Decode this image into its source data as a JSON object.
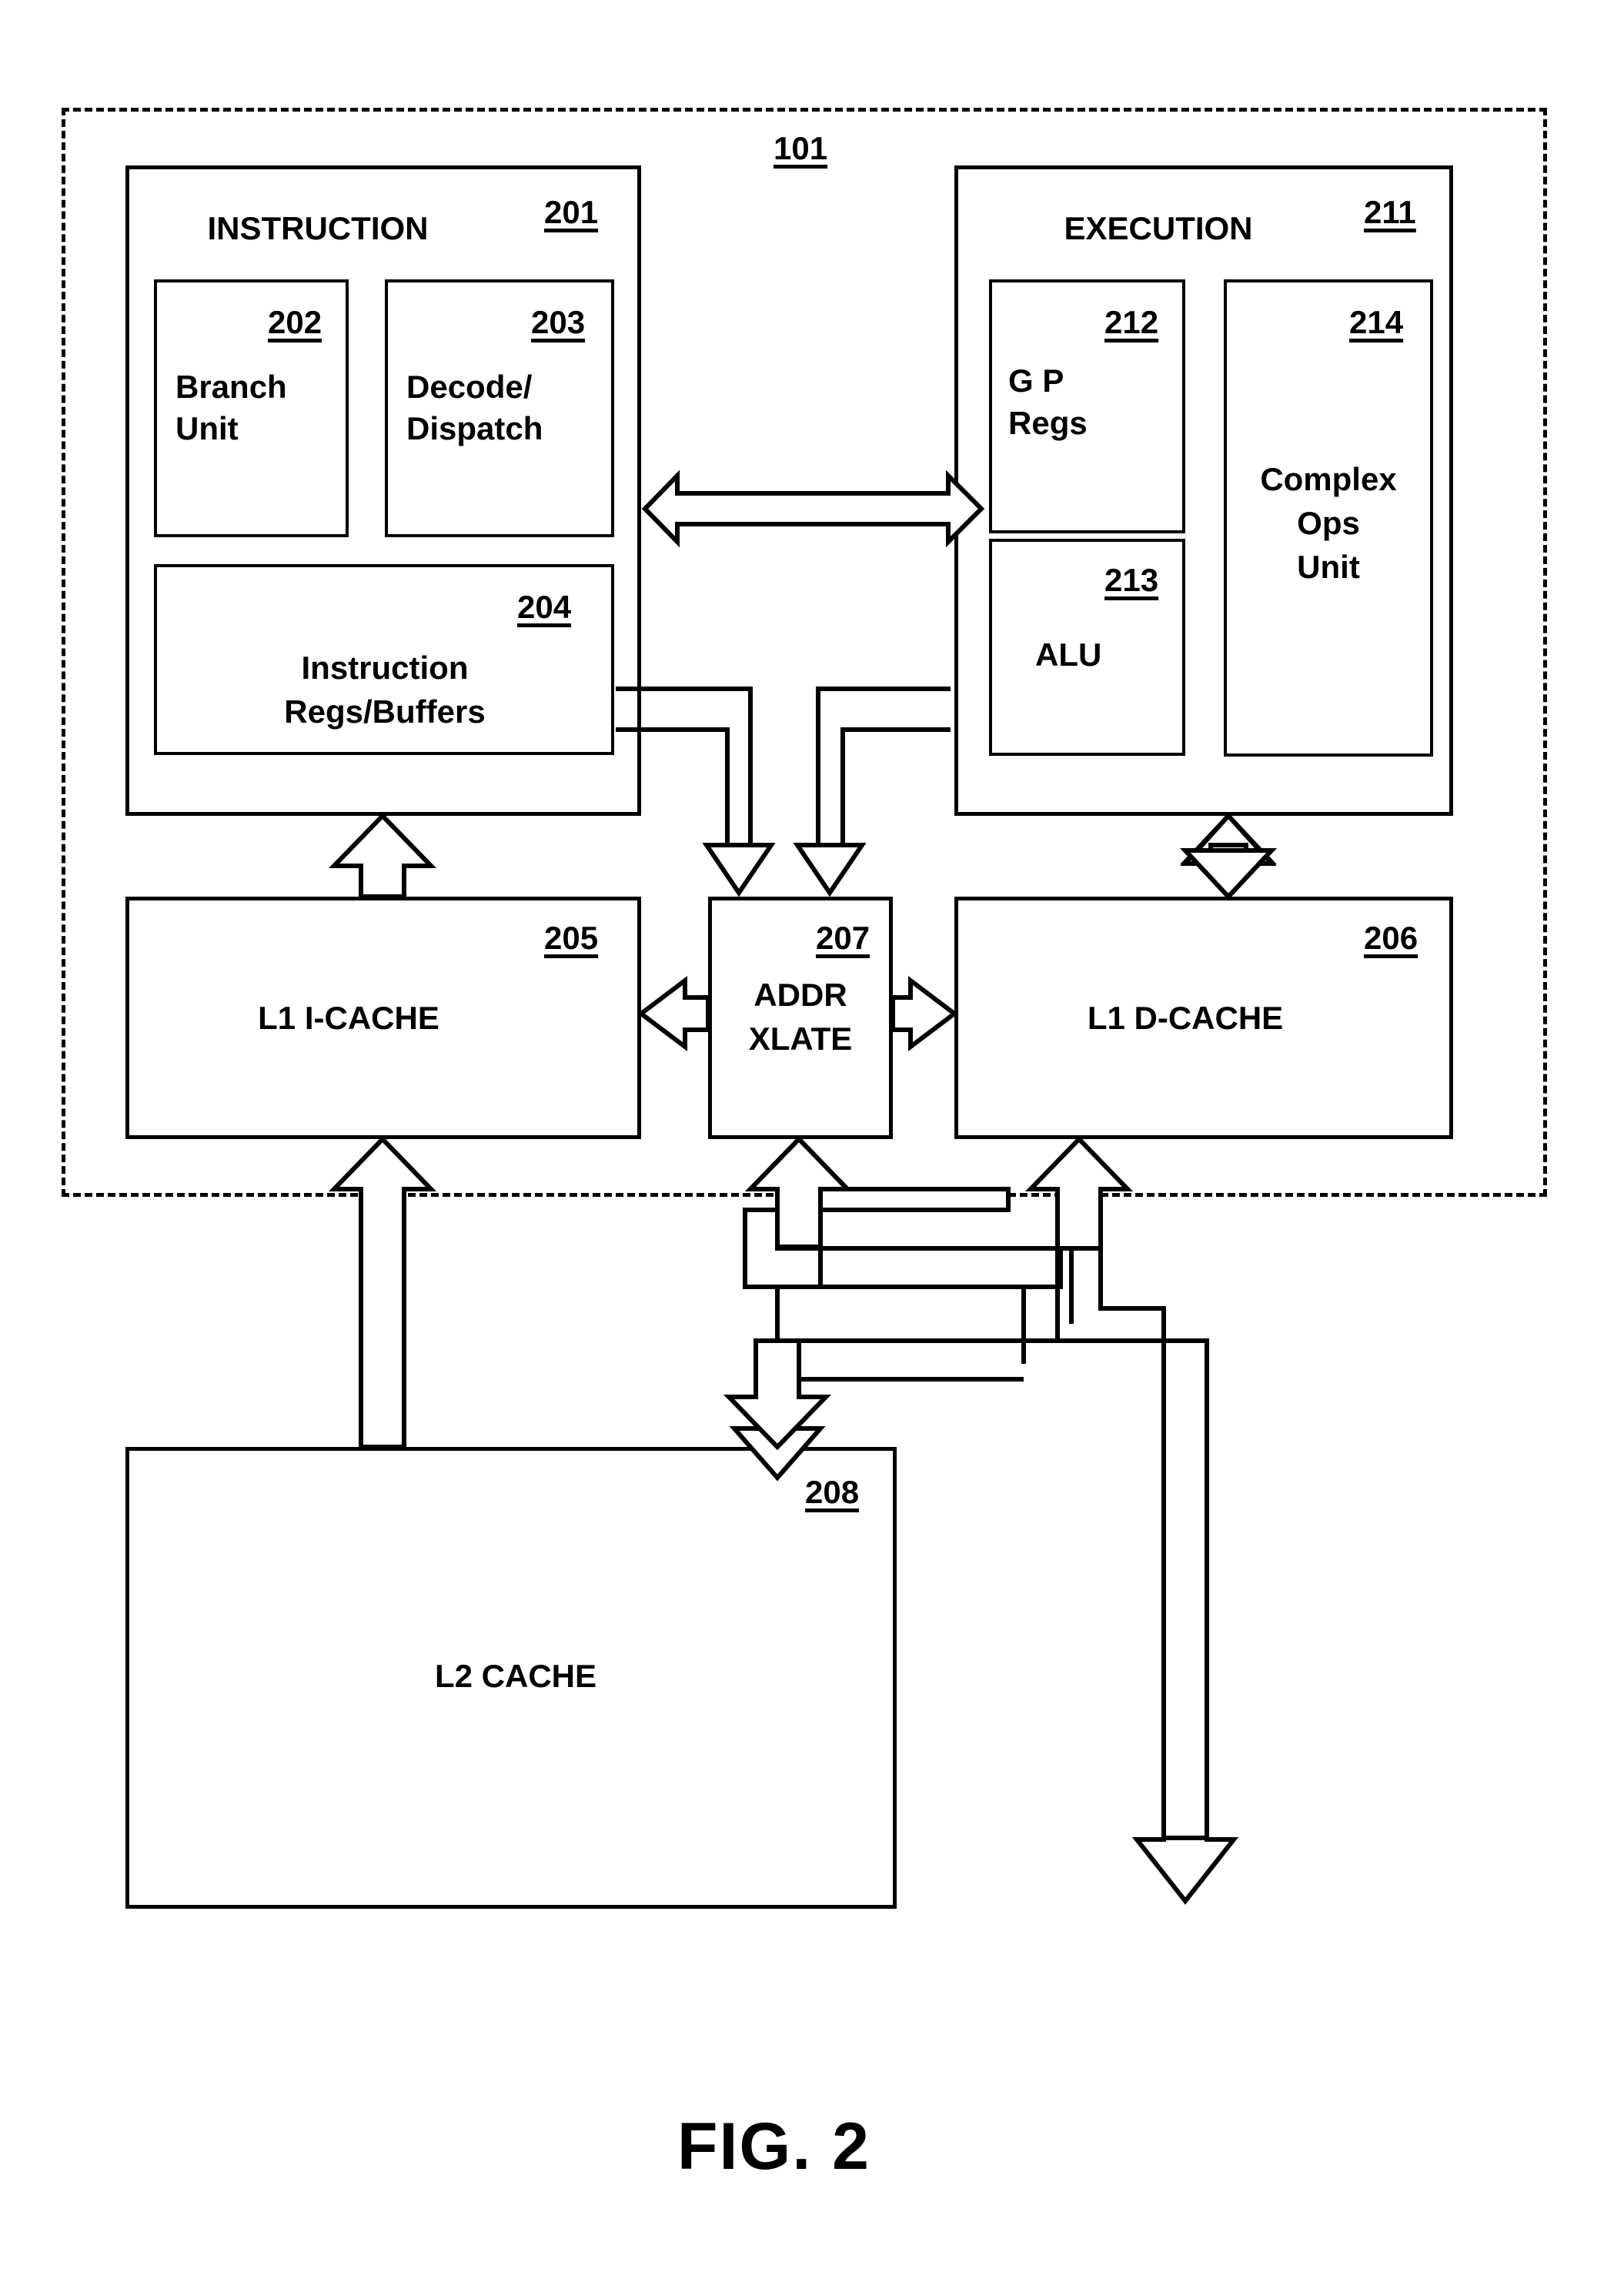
{
  "figure": {
    "caption": "FIG. 2",
    "chip_ref": "101"
  },
  "blocks": {
    "instruction_unit": {
      "title": "INSTRUCTION",
      "ref": "201"
    },
    "branch_unit": {
      "title_line1": "Branch",
      "title_line2": "Unit",
      "ref": "202"
    },
    "decode_dispatch": {
      "title_line1": "Decode/",
      "title_line2": "Dispatch",
      "ref": "203"
    },
    "instruction_regs": {
      "title_line1": "Instruction",
      "title_line2": "Regs/Buffers",
      "ref": "204"
    },
    "execution_unit": {
      "title": "EXECUTION",
      "ref": "211"
    },
    "gp_regs": {
      "title_line1": "G P",
      "title_line2": "Regs",
      "ref": "212"
    },
    "alu": {
      "title": "ALU",
      "ref": "213"
    },
    "complex_ops": {
      "title_line1": "Complex",
      "title_line2": "Ops",
      "title_line3": "Unit",
      "ref": "214"
    },
    "l1_icache": {
      "title": "L1   I-CACHE",
      "ref": "205"
    },
    "addr_xlate": {
      "title_line1": "ADDR",
      "title_line2": "XLATE",
      "ref": "207"
    },
    "l1_dcache": {
      "title": "L1   D-CACHE",
      "ref": "206"
    },
    "l2_cache": {
      "title": "L2    CACHE",
      "ref": "208"
    }
  },
  "colors": {
    "stroke": "#000000",
    "fill": "#ffffff"
  }
}
